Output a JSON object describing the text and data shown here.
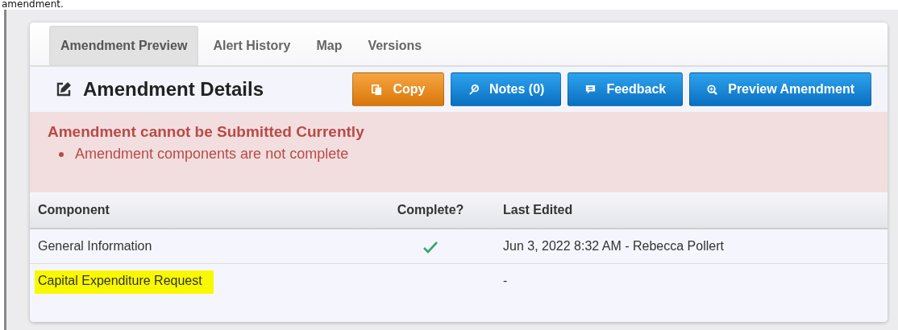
{
  "caption": "amendment.",
  "tabs": [
    {
      "label": "Amendment Preview",
      "selected": true
    },
    {
      "label": "Alert History",
      "selected": false
    },
    {
      "label": "Map",
      "selected": false
    },
    {
      "label": "Versions",
      "selected": false
    }
  ],
  "header": {
    "title": "Amendment Details"
  },
  "buttons": [
    {
      "label": "Copy",
      "kind": "copy"
    },
    {
      "label": "Notes (0)",
      "kind": "notes"
    },
    {
      "label": "Feedback",
      "kind": "feedback"
    },
    {
      "label": "Preview Amendment",
      "kind": "preview"
    }
  ],
  "alert": {
    "title": "Amendment cannot be Submitted Currently",
    "items": [
      "Amendment components are not complete"
    ]
  },
  "table": {
    "columns": [
      "Component",
      "Complete?",
      "Last Edited"
    ],
    "rows": [
      {
        "component": "General Information",
        "complete": true,
        "last_edited": "Jun 3, 2022 8:32 AM - Rebecca Pollert",
        "highlighted": false
      },
      {
        "component": "Capital Expenditure Request",
        "complete": false,
        "last_edited": "-",
        "highlighted": true
      }
    ]
  }
}
